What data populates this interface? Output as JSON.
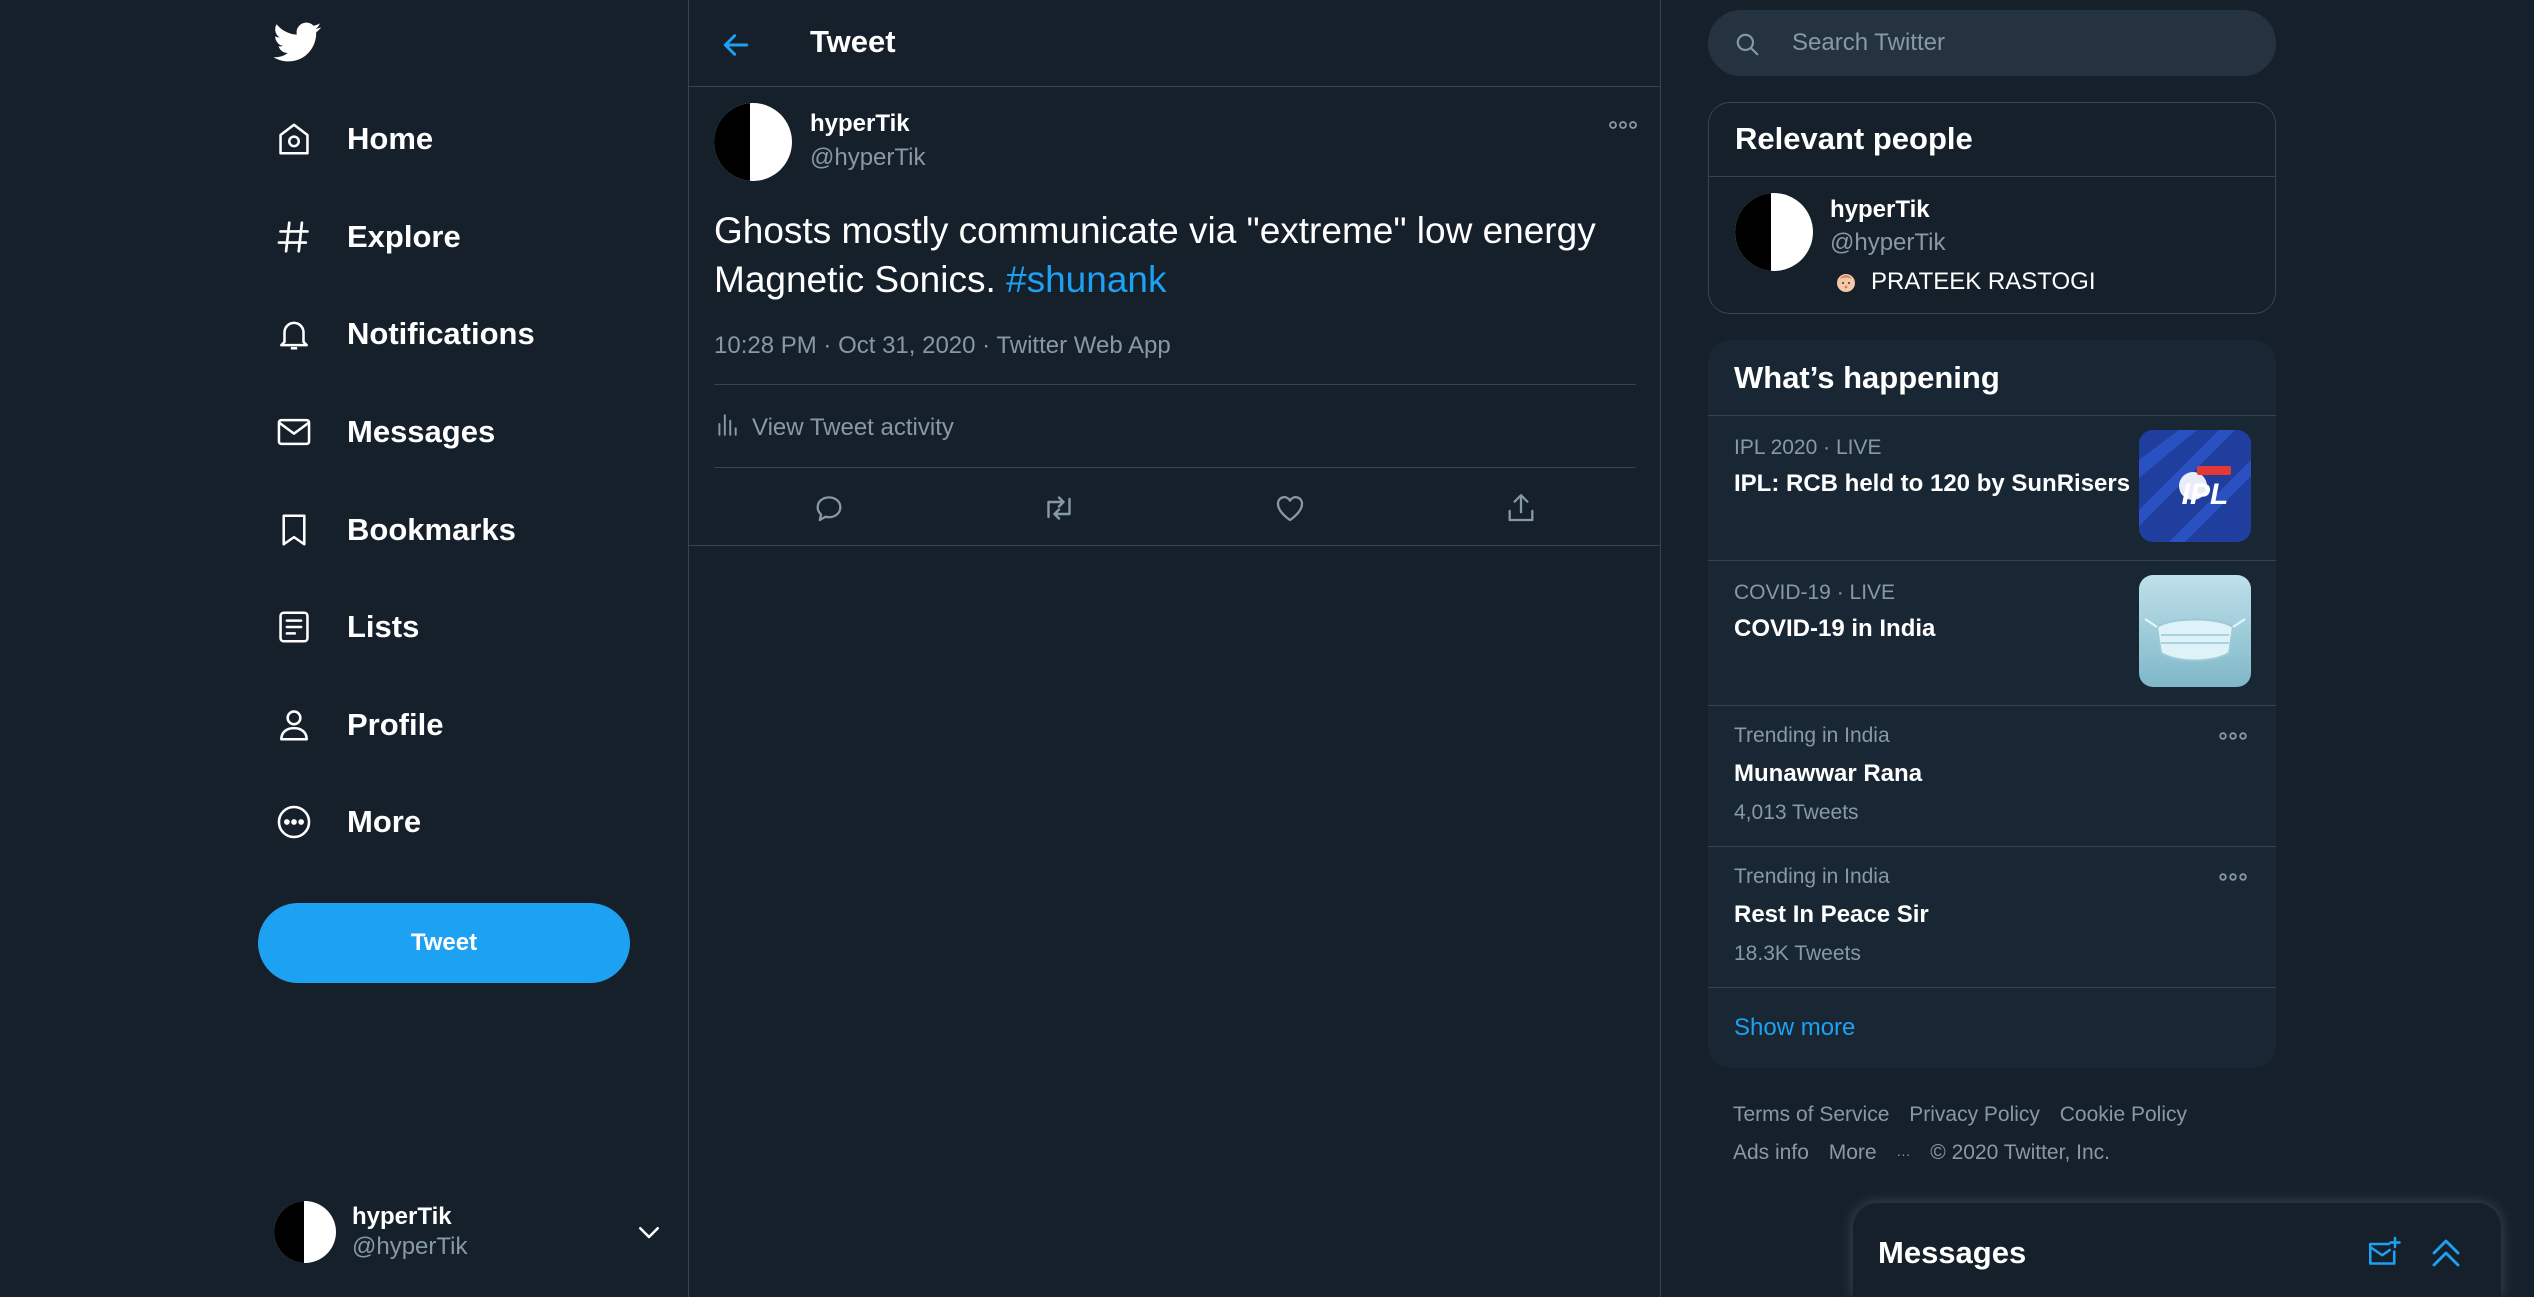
{
  "nav": {
    "items": [
      {
        "label": "Home",
        "icon": "home-icon"
      },
      {
        "label": "Explore",
        "icon": "hashtag-icon"
      },
      {
        "label": "Notifications",
        "icon": "bell-icon"
      },
      {
        "label": "Messages",
        "icon": "envelope-icon"
      },
      {
        "label": "Bookmarks",
        "icon": "bookmark-icon"
      },
      {
        "label": "Lists",
        "icon": "list-icon"
      },
      {
        "label": "Profile",
        "icon": "person-icon"
      },
      {
        "label": "More",
        "icon": "more-circle-icon"
      }
    ],
    "tweet_button": "Tweet",
    "account": {
      "name": "hyperTik",
      "handle": "@hyperTik"
    }
  },
  "header": {
    "title": "Tweet"
  },
  "tweet": {
    "author_name": "hyperTik",
    "author_handle": "@hyperTik",
    "text": "Ghosts mostly communicate via \"extreme\" low energy Magnetic Sonics.",
    "hashtag": "#shunank",
    "time": "10:28 PM",
    "date": "Oct 31, 2020",
    "source": "Twitter Web App",
    "activity_label": "View Tweet activity"
  },
  "search": {
    "placeholder": "Search Twitter"
  },
  "relevant_people": {
    "title": "Relevant people",
    "person": {
      "name": "hyperTik",
      "handle": "@hyperTik",
      "bio": "PRATEEK RASTOGI"
    }
  },
  "whats_happening": {
    "title": "What’s happening",
    "trends": [
      {
        "context": "IPL 2020 · LIVE",
        "title": "IPL: RCB held to 120 by SunRisers",
        "count": "",
        "thumb": "IPL"
      },
      {
        "context": "COVID-19 · LIVE",
        "title": "COVID-19 in India",
        "count": "",
        "thumb": ""
      },
      {
        "context": "Trending in India",
        "title": "Munawwar Rana",
        "count": "4,013 Tweets",
        "thumb": ""
      },
      {
        "context": "Trending in India",
        "title": "Rest In Peace Sir",
        "count": "18.3K Tweets",
        "thumb": ""
      }
    ],
    "show_more": "Show more"
  },
  "footer": {
    "links": [
      "Terms of Service",
      "Privacy Policy",
      "Cookie Policy",
      "Ads info",
      "More"
    ],
    "more_glyph": "···",
    "copyright": "© 2020 Twitter, Inc."
  },
  "messages_dock": {
    "title": "Messages"
  },
  "colors": {
    "accent": "#1da1f2",
    "background": "#15202b",
    "card": "#192734",
    "secondary_text": "#8899a6",
    "border": "#38444d"
  }
}
